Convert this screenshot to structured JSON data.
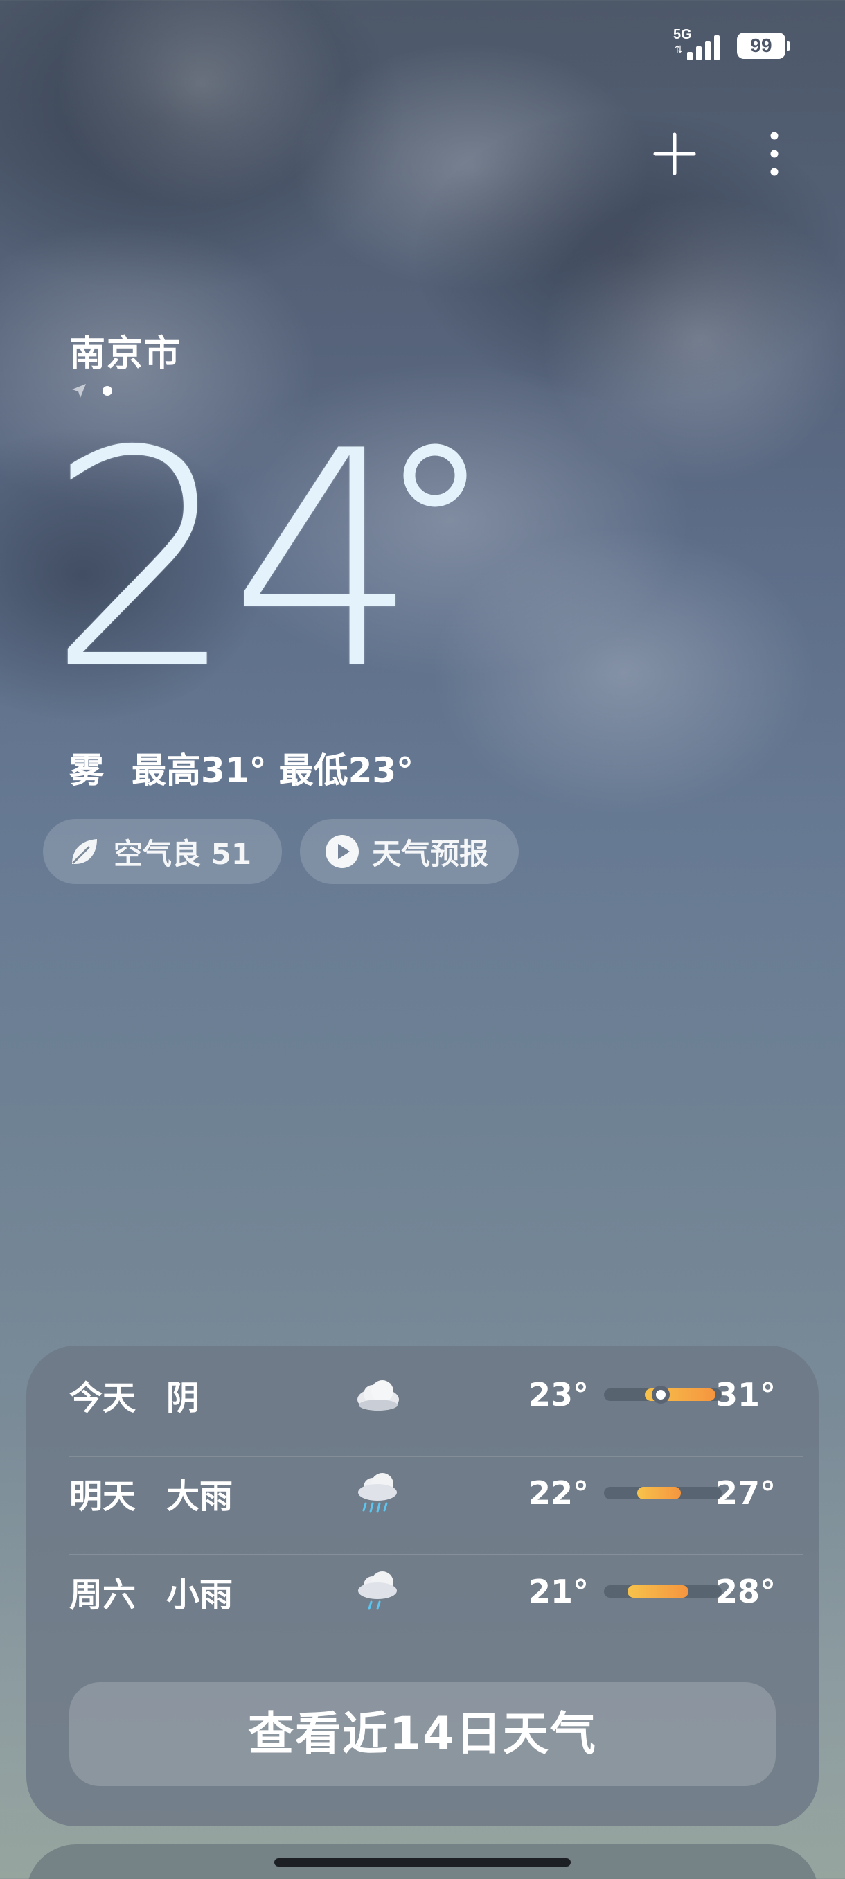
{
  "status_bar": {
    "network": "5G",
    "battery": "99"
  },
  "location": {
    "city": "南京市"
  },
  "current": {
    "temperature": "24",
    "condition": "雾",
    "high": "最高31°",
    "low": "最低23°"
  },
  "chips": {
    "air_quality": "空气良 51",
    "forecast_video": "天气预报"
  },
  "daily": [
    {
      "day": "今天",
      "condition": "阴",
      "icon": "cloudy-icon",
      "low": "23°",
      "high": "31°",
      "range_start": 0.35,
      "range_end": 0.95,
      "now": 0.48
    },
    {
      "day": "明天",
      "condition": "大雨",
      "icon": "heavy-rain-icon",
      "low": "22°",
      "high": "27°",
      "range_start": 0.28,
      "range_end": 0.65
    },
    {
      "day": "周六",
      "condition": "小雨",
      "icon": "light-rain-icon",
      "low": "21°",
      "high": "28°",
      "range_start": 0.2,
      "range_end": 0.72
    }
  ],
  "actions": {
    "view_14_days": "查看近14日天气"
  },
  "colors": {
    "range_start": "#f7c34b",
    "range_end": "#f5953f"
  }
}
